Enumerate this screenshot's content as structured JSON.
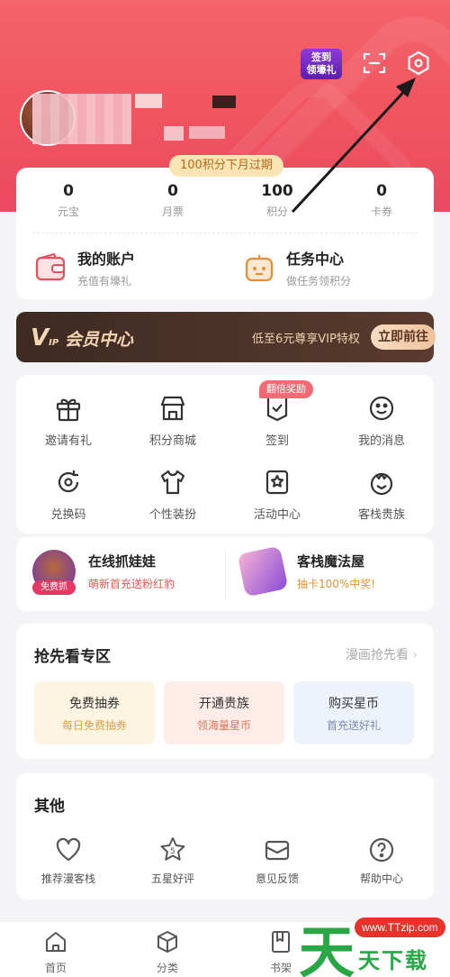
{
  "header": {
    "signin_badge": "签到\n领壕礼"
  },
  "expire_tag": "100积分下月过期",
  "stats": [
    {
      "value": "0",
      "label": "元宝"
    },
    {
      "value": "0",
      "label": "月票"
    },
    {
      "value": "100",
      "label": "积分"
    },
    {
      "value": "0",
      "label": "卡券"
    }
  ],
  "account": {
    "title": "我的账户",
    "subtitle": "充值有壕礼"
  },
  "tasks": {
    "title": "任务中心",
    "subtitle": "做任务领积分"
  },
  "vip": {
    "logo": "会员中心",
    "logo_mark": "V",
    "logo_sub": "IP",
    "desc": "低至6元尊享VIP特权",
    "button": "立即前往"
  },
  "grid": {
    "double_tag": "翻倍奖励",
    "items": [
      {
        "label": "邀请有礼",
        "icon": "gift-icon"
      },
      {
        "label": "积分商城",
        "icon": "store-icon"
      },
      {
        "label": "签到",
        "icon": "checkin-icon"
      },
      {
        "label": "我的消息",
        "icon": "smile-message-icon"
      },
      {
        "label": "兑换码",
        "icon": "redeem-icon"
      },
      {
        "label": "个性装扮",
        "icon": "tshirt-icon"
      },
      {
        "label": "活动中心",
        "icon": "star-badge-icon"
      },
      {
        "label": "客栈贵族",
        "icon": "crown-icon"
      }
    ]
  },
  "promo": {
    "left": {
      "title": "在线抓娃娃",
      "subtitle": "萌新首充送粉红豹",
      "badge": "免费抓"
    },
    "right": {
      "title": "客栈魔法屋",
      "subtitle": "抽卡100%中奖!"
    }
  },
  "preview": {
    "title": "抢先看专区",
    "more": "漫画抢先看",
    "tiles": [
      {
        "title": "免费抽券",
        "subtitle": "每日免费抽券",
        "subtitle_color": "#d9a24a"
      },
      {
        "title": "开通贵族",
        "subtitle": "领海量星币",
        "subtitle_color": "#e0735a"
      },
      {
        "title": "购买星币",
        "subtitle": "首充送好礼",
        "subtitle_color": "#7a8bb0"
      }
    ]
  },
  "other": {
    "title": "其他",
    "items": [
      {
        "label": "推荐漫客栈",
        "icon": "heart-icon"
      },
      {
        "label": "五星好评",
        "icon": "five-star-icon"
      },
      {
        "label": "意见反馈",
        "icon": "feedback-box-icon"
      },
      {
        "label": "帮助中心",
        "icon": "help-icon"
      }
    ]
  },
  "tabbar": [
    {
      "label": "首页",
      "icon": "home-icon"
    },
    {
      "label": "分类",
      "icon": "category-cube-icon"
    },
    {
      "label": "书架",
      "icon": "bookshelf-icon"
    }
  ],
  "watermark": {
    "site": "www.TTzip.com",
    "big": "天",
    "small": "天下载"
  }
}
